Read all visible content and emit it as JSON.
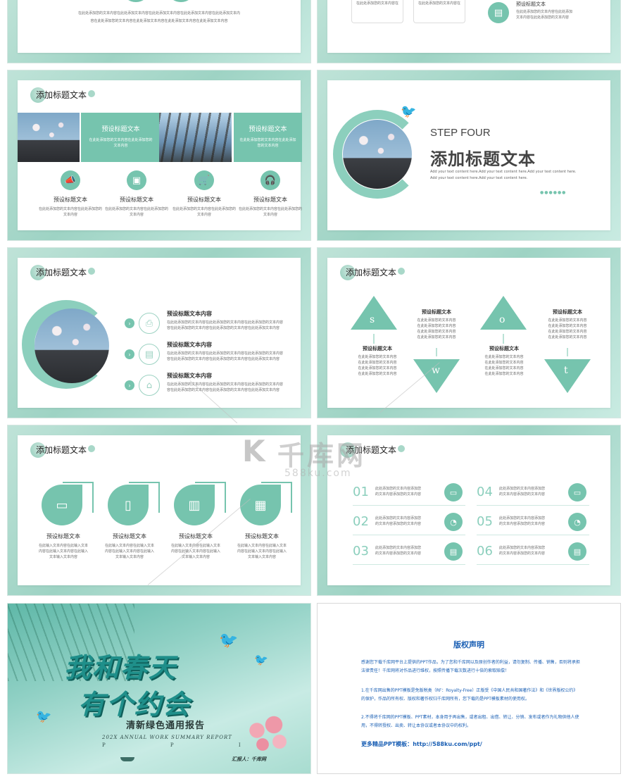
{
  "colors": {
    "accent": "#76c4ae",
    "frame": "#a8d9ca",
    "dark_teal": "#1f8f8a",
    "link_blue": "#1a5fb4"
  },
  "slide1": {
    "line1": "在此处添加您的文本内容在此处添加文本内容在此处添加文本内容在此处添加文本内容在此处添加文本内",
    "line2": "容在此处添加您的文本内容在此处添加文本内容在此处添加文本内容在此处添加文本内容"
  },
  "slide2": {
    "card_text": "在此处添加您的文本内容在",
    "item_title": "预设标题文本",
    "item_text1": "在此处添加您的文本内容在此处添加",
    "item_text2": "文本内容在此处添加您的文本内容"
  },
  "slide3": {
    "title": "添加标题文本",
    "panel_title": "预设标题文本",
    "panel_text": "在此处添加您的文本内容在此处添加您的文本内容",
    "items": [
      {
        "icon": "megaphone-icon",
        "title": "预设标题文本",
        "text": "在此处添加您的文本内容在此处添加您的文本内容"
      },
      {
        "icon": "shopping-bag-icon",
        "title": "预设标题文本",
        "text": "在此处添加您的文本内容在此处添加您的文本内容"
      },
      {
        "icon": "cart-icon",
        "title": "预设标题文本",
        "text": "在此处添加您的文本内容在此处添加您的文本内容"
      },
      {
        "icon": "headphones-icon",
        "title": "预设标题文本",
        "text": "在此处添加您的文本内容在此处添加您的文本内容"
      }
    ]
  },
  "slide4": {
    "step": "STEP FOUR",
    "title": "添加标题文本",
    "sub1": "Add your text content here.Add your text content here.Add your text content here.",
    "sub2": "Add your text content here.Add your text content here.",
    "dots": "●●●●●●"
  },
  "slide5": {
    "title": "添加标题文本",
    "items": [
      {
        "icon": "printer-icon",
        "title": "预设标题文本内容",
        "text1": "在此处添加您的文本内容在此处添加您的文本内容在此处添加您的文本内容",
        "text2": "容在此处添加您的文本内容在此处添加您的文本内容在此处添加文本内容"
      },
      {
        "icon": "document-icon",
        "title": "预设标题文本内容",
        "text1": "在此处添加您的文本内容在此处添加您的文本内容在此处添加您的文本内容",
        "text2": "容在此处添加您的文本内容在此处添加您的文本内容在此处添加文本内容"
      },
      {
        "icon": "house-icon",
        "title": "预设标题文本内容",
        "text1": "在此处添加您的文本内容在此处添加您的文本内容在此处添加您的文本内容",
        "text2": "容在此处添加您的文本内容在此处添加您的文本内容在此处添加文本内容"
      }
    ]
  },
  "slide6": {
    "title": "添加标题文本",
    "letters": [
      "s",
      "w",
      "o",
      "t"
    ],
    "blocks": [
      {
        "title": "预设标题文本",
        "text": [
          "在此处添加您的文本内容",
          "在此处添加您的文本内容",
          "在此处添加您的文本内容",
          "在此处添加您的文本内容"
        ]
      },
      {
        "title": "预设标题文本",
        "text": [
          "在此处添加您的文本内容",
          "在此处添加您的文本内容",
          "在此处添加您的文本内容",
          "在此处添加您的文本内容"
        ]
      },
      {
        "title": "预设标题文本",
        "text": [
          "在此处添加您的文本内容",
          "在此处添加您的文本内容",
          "在此处添加您的文本内容",
          "在此处添加您的文本内容"
        ]
      },
      {
        "title": "预设标题文本",
        "text": [
          "在此处添加您的文本内容",
          "在此处添加您的文本内容",
          "在此处添加您的文本内容",
          "在此处添加您的文本内容"
        ]
      }
    ]
  },
  "slide7": {
    "title": "添加标题文本",
    "items": [
      {
        "icon": "monitor-icon",
        "title": "预设标题文本",
        "text": [
          "在此输入文本内容在此输入文本",
          "内容在此输入文本内容在此输入",
          "文本输入文本内容"
        ]
      },
      {
        "icon": "phone-icon",
        "title": "预设标题文本",
        "text": [
          "在此输入文本内容在此输入文本",
          "内容在此输入文本内容在此输入",
          "文本输入文本内容"
        ]
      },
      {
        "icon": "bar-chart-icon",
        "title": "预设标题文本",
        "text": [
          "在此输入文本内容在此输入文本",
          "内容在此输入文本内容在此输入",
          "文本输入文本内容"
        ]
      },
      {
        "icon": "calendar-icon",
        "title": "预设标题文本",
        "text": [
          "在此输入文本内容在此输入文本",
          "内容在此输入文本内容在此输入",
          "文本输入文本内容"
        ]
      }
    ]
  },
  "slide8": {
    "title": "添加标题文本",
    "items": [
      {
        "num": "01",
        "icon": "laptop-icon",
        "text1": "此处添加您的文本内容添加您",
        "text2": "的文本内容添加您的文本内容"
      },
      {
        "num": "02",
        "icon": "alarm-icon",
        "text1": "此处添加您的文本内容添加您",
        "text2": "的文本内容添加您的文本内容"
      },
      {
        "num": "03",
        "icon": "doc-icon",
        "text1": "此处添加您的文本内容添加您",
        "text2": "的文本内容添加您的文本内容"
      },
      {
        "num": "04",
        "icon": "laptop-icon",
        "text1": "此处添加您的文本内容添加您",
        "text2": "的文本内容添加您的文本内容"
      },
      {
        "num": "05",
        "icon": "alarm-icon",
        "text1": "此处添加您的文本内容添加您",
        "text2": "的文本内容添加您的文本内容"
      },
      {
        "num": "06",
        "icon": "doc-icon",
        "text1": "此处添加您的文本内容添加您",
        "text2": "的文本内容添加您的文本内容"
      }
    ]
  },
  "watermark": {
    "brand": "千库网",
    "url": "588ku.com"
  },
  "slide9": {
    "title_line1": "我和春天",
    "title_line2": "有个约会",
    "subtitle": "清新绿色通用报告",
    "en": "202X ANNUAL WORK SUMMARY REPORT",
    "letters": "P  P  I",
    "presenter": "汇报人：千库网"
  },
  "slide10": {
    "title": "版权声明",
    "p1": "感谢您下载千库网平台上提供的PPT作品，为了您和千库网以及原创作者的利益，请勿复制、传播、销售，否则将承担法律责任！千库网将对作品进行维权，按照传播下载次数进行十倍的索取赔偿！",
    "p2": "1.在千库网出售的PPT模板是免版税类（RF：Royalty-Free）正版受《中国人民共和国著作法》和《世界版权公约》的保护，作品的所有权、版权和著作权归千库网所有，您下载的是PPT模板素材的使用权。",
    "p3": "2.不得将千库网的PPT模板、PPT素材，本身用于再出售，或者出租、出借、转让、分销、发布或者作为礼物供他人使用，不得转授权、出卖、转让本协议或者本协议中的权利。",
    "more_label": "更多精品PPT模板：",
    "more_url": "http://588ku.com/ppt/"
  }
}
